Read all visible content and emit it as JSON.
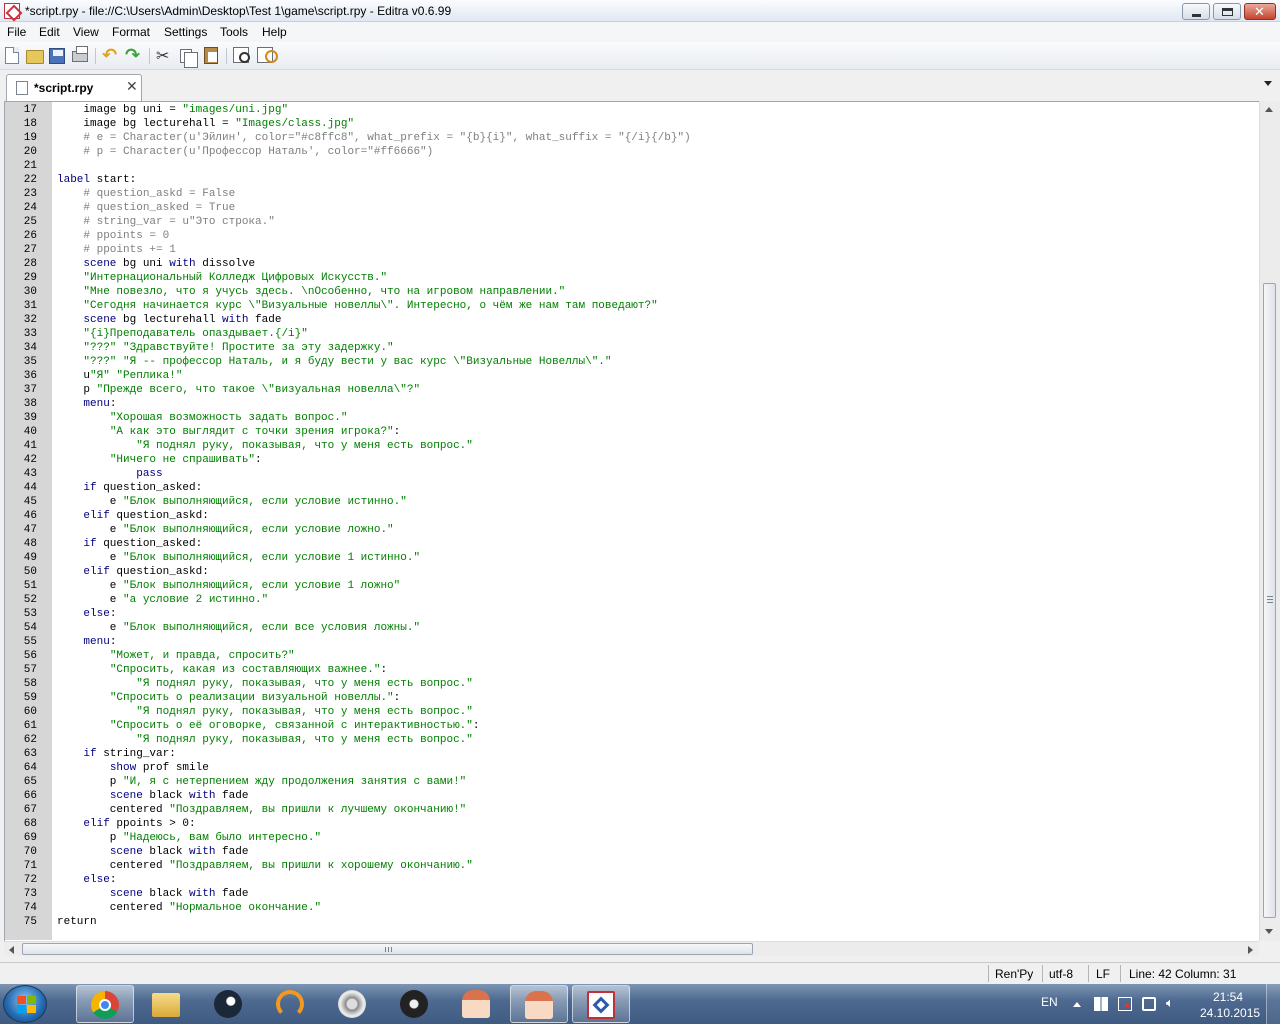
{
  "window": {
    "title": "*script.rpy - file://C:\\Users\\Admin\\Desktop\\Test 1\\game\\script.rpy - Editra v0.6.99",
    "close_glyph": "✕"
  },
  "menu": [
    "File",
    "Edit",
    "View",
    "Format",
    "Settings",
    "Tools",
    "Help"
  ],
  "toolbar_icons": [
    "new-file-icon",
    "open-folder-icon",
    "save-icon",
    "print-icon",
    "undo-icon",
    "redo-icon",
    "cut-icon",
    "copy-icon",
    "paste-icon",
    "find-icon",
    "find-replace-icon"
  ],
  "tab": {
    "label": "*script.rpy",
    "close_glyph": "✕"
  },
  "colors": {
    "keyword": "#00007f",
    "string": "#007f00",
    "comment": "#7f7f7f",
    "gutter": "#d6d6d6"
  },
  "editor": {
    "lines": [
      {
        "n": "17",
        "parts": [
          [
            "t",
            "    image bg uni = "
          ],
          [
            "s",
            "\"images/uni.jpg\""
          ]
        ]
      },
      {
        "n": "18",
        "parts": [
          [
            "t",
            "    image bg lecturehall = "
          ],
          [
            "s",
            "\"Images/class.jpg\""
          ]
        ]
      },
      {
        "n": "19",
        "parts": [
          [
            "c",
            "    # e = Character(u'Эйлин', color=\"#c8ffc8\", what_prefix = \"{b}{i}\", what_suffix = \"{/i}{/b}\")"
          ]
        ]
      },
      {
        "n": "20",
        "parts": [
          [
            "c",
            "    # p = Character(u'Профессор Наталь', color=\"#ff6666\")"
          ]
        ]
      },
      {
        "n": "21",
        "parts": []
      },
      {
        "n": "22",
        "parts": [
          [
            "k",
            "label"
          ],
          [
            "t",
            " start:"
          ]
        ]
      },
      {
        "n": "23",
        "parts": [
          [
            "c",
            "    # question_askd = False"
          ]
        ]
      },
      {
        "n": "24",
        "parts": [
          [
            "c",
            "    # question_asked = True"
          ]
        ]
      },
      {
        "n": "25",
        "parts": [
          [
            "c",
            "    # string_var = u\"Это строка.\""
          ]
        ]
      },
      {
        "n": "26",
        "parts": [
          [
            "c",
            "    # ppoints = 0"
          ]
        ]
      },
      {
        "n": "27",
        "parts": [
          [
            "c",
            "    # ppoints += 1"
          ]
        ]
      },
      {
        "n": "28",
        "parts": [
          [
            "t",
            "    "
          ],
          [
            "k",
            "scene"
          ],
          [
            "t",
            " bg uni "
          ],
          [
            "k",
            "with"
          ],
          [
            "t",
            " dissolve"
          ]
        ]
      },
      {
        "n": "29",
        "parts": [
          [
            "t",
            "    "
          ],
          [
            "s",
            "\"Интернациональный Колледж Цифровых Искусств.\""
          ]
        ]
      },
      {
        "n": "30",
        "parts": [
          [
            "t",
            "    "
          ],
          [
            "s",
            "\"Мне повезло, что я учусь здесь. \\nОсобенно, что на игровом направлении.\""
          ]
        ]
      },
      {
        "n": "31",
        "parts": [
          [
            "t",
            "    "
          ],
          [
            "s",
            "\"Сегодня начинается курс \\\"Визуальные новеллы\\\". Интересно, о чём же нам там поведают?\""
          ]
        ]
      },
      {
        "n": "32",
        "parts": [
          [
            "t",
            "    "
          ],
          [
            "k",
            "scene"
          ],
          [
            "t",
            " bg lecturehall "
          ],
          [
            "k",
            "with"
          ],
          [
            "t",
            " fade"
          ]
        ]
      },
      {
        "n": "33",
        "parts": [
          [
            "t",
            "    "
          ],
          [
            "s",
            "\"{i}Преподаватель опаздывает.{/i}\""
          ]
        ]
      },
      {
        "n": "34",
        "parts": [
          [
            "t",
            "    "
          ],
          [
            "s",
            "\"???\" \"Здравствуйте! Простите за эту задержку.\""
          ]
        ]
      },
      {
        "n": "35",
        "parts": [
          [
            "t",
            "    "
          ],
          [
            "s",
            "\"???\" \"Я -- профессор Наталь, и я буду вести у вас курс \\\"Визуальные Новеллы\\\".\""
          ]
        ]
      },
      {
        "n": "36",
        "parts": [
          [
            "t",
            "    u"
          ],
          [
            "s",
            "\"Я\" \"Реплика!\""
          ]
        ]
      },
      {
        "n": "37",
        "parts": [
          [
            "t",
            "    p "
          ],
          [
            "s",
            "\"Прежде всего, что такое \\\"визуальная новелла\\\"?\""
          ]
        ]
      },
      {
        "n": "38",
        "parts": [
          [
            "t",
            "    "
          ],
          [
            "k",
            "menu"
          ],
          [
            "t",
            ":"
          ]
        ]
      },
      {
        "n": "39",
        "parts": [
          [
            "t",
            "        "
          ],
          [
            "s",
            "\"Хорошая возможность задать вопрос.\""
          ]
        ]
      },
      {
        "n": "40",
        "parts": [
          [
            "t",
            "        "
          ],
          [
            "s",
            "\"А как это выглядит с точки зрения игрока?\""
          ],
          [
            "t",
            ":"
          ]
        ]
      },
      {
        "n": "41",
        "parts": [
          [
            "t",
            "            "
          ],
          [
            "s",
            "\"Я поднял руку, показывая, что у меня есть вопрос.\""
          ]
        ]
      },
      {
        "n": "42",
        "parts": [
          [
            "t",
            "        "
          ],
          [
            "s",
            "\"Ничего не спрашивать\""
          ],
          [
            "t",
            ":"
          ]
        ]
      },
      {
        "n": "43",
        "parts": [
          [
            "t",
            "            "
          ],
          [
            "k",
            "pass"
          ]
        ]
      },
      {
        "n": "44",
        "parts": [
          [
            "t",
            "    "
          ],
          [
            "k",
            "if"
          ],
          [
            "t",
            " question_asked:"
          ]
        ]
      },
      {
        "n": "45",
        "parts": [
          [
            "t",
            "        e "
          ],
          [
            "s",
            "\"Блок выполняющийся, если условие истинно.\""
          ]
        ]
      },
      {
        "n": "46",
        "parts": [
          [
            "t",
            "    "
          ],
          [
            "k",
            "elif"
          ],
          [
            "t",
            " question_askd:"
          ]
        ]
      },
      {
        "n": "47",
        "parts": [
          [
            "t",
            "        e "
          ],
          [
            "s",
            "\"Блок выполняющийся, если условие ложно.\""
          ]
        ]
      },
      {
        "n": "48",
        "parts": [
          [
            "t",
            "    "
          ],
          [
            "k",
            "if"
          ],
          [
            "t",
            " question_asked:"
          ]
        ]
      },
      {
        "n": "49",
        "parts": [
          [
            "t",
            "        e "
          ],
          [
            "s",
            "\"Блок выполняющийся, если условие 1 истинно.\""
          ]
        ]
      },
      {
        "n": "50",
        "parts": [
          [
            "t",
            "    "
          ],
          [
            "k",
            "elif"
          ],
          [
            "t",
            " question_askd:"
          ]
        ]
      },
      {
        "n": "51",
        "parts": [
          [
            "t",
            "        e "
          ],
          [
            "s",
            "\"Блок выполняющийся, если условие 1 ложно\""
          ]
        ]
      },
      {
        "n": "52",
        "parts": [
          [
            "t",
            "        e "
          ],
          [
            "s",
            "\"а условие 2 истинно.\""
          ]
        ]
      },
      {
        "n": "53",
        "parts": [
          [
            "t",
            "    "
          ],
          [
            "k",
            "else"
          ],
          [
            "t",
            ":"
          ]
        ]
      },
      {
        "n": "54",
        "parts": [
          [
            "t",
            "        e "
          ],
          [
            "s",
            "\"Блок выполняющийся, если все условия ложны.\""
          ]
        ]
      },
      {
        "n": "55",
        "parts": [
          [
            "t",
            "    "
          ],
          [
            "k",
            "menu"
          ],
          [
            "t",
            ":"
          ]
        ]
      },
      {
        "n": "56",
        "parts": [
          [
            "t",
            "        "
          ],
          [
            "s",
            "\"Может, и правда, спросить?\""
          ]
        ]
      },
      {
        "n": "57",
        "parts": [
          [
            "t",
            "        "
          ],
          [
            "s",
            "\"Спросить, какая из составляющих важнее.\""
          ],
          [
            "t",
            ":"
          ]
        ]
      },
      {
        "n": "58",
        "parts": [
          [
            "t",
            "            "
          ],
          [
            "s",
            "\"Я поднял руку, показывая, что у меня есть вопрос.\""
          ]
        ]
      },
      {
        "n": "59",
        "parts": [
          [
            "t",
            "        "
          ],
          [
            "s",
            "\"Спросить о реализации визуальной новеллы.\""
          ],
          [
            "t",
            ":"
          ]
        ]
      },
      {
        "n": "60",
        "parts": [
          [
            "t",
            "            "
          ],
          [
            "s",
            "\"Я поднял руку, показывая, что у меня есть вопрос.\""
          ]
        ]
      },
      {
        "n": "61",
        "parts": [
          [
            "t",
            "        "
          ],
          [
            "s",
            "\"Спросить о её оговорке, связанной с интерактивностью.\""
          ],
          [
            "t",
            ":"
          ]
        ]
      },
      {
        "n": "62",
        "parts": [
          [
            "t",
            "            "
          ],
          [
            "s",
            "\"Я поднял руку, показывая, что у меня есть вопрос.\""
          ]
        ]
      },
      {
        "n": "63",
        "parts": [
          [
            "t",
            "    "
          ],
          [
            "k",
            "if"
          ],
          [
            "t",
            " string_var:"
          ]
        ]
      },
      {
        "n": "64",
        "parts": [
          [
            "t",
            "        "
          ],
          [
            "k",
            "show"
          ],
          [
            "t",
            " prof smile"
          ]
        ]
      },
      {
        "n": "65",
        "parts": [
          [
            "t",
            "        p "
          ],
          [
            "s",
            "\"И, я с нетерпением жду продолжения занятия с вами!\""
          ]
        ]
      },
      {
        "n": "66",
        "parts": [
          [
            "t",
            "        "
          ],
          [
            "k",
            "scene"
          ],
          [
            "t",
            " black "
          ],
          [
            "k",
            "with"
          ],
          [
            "t",
            " fade"
          ]
        ]
      },
      {
        "n": "67",
        "parts": [
          [
            "t",
            "        centered "
          ],
          [
            "s",
            "\"Поздравляем, вы пришли к лучшему окончанию!\""
          ]
        ]
      },
      {
        "n": "68",
        "parts": [
          [
            "t",
            "    "
          ],
          [
            "k",
            "elif"
          ],
          [
            "t",
            " ppoints > 0:"
          ]
        ]
      },
      {
        "n": "69",
        "parts": [
          [
            "t",
            "        p "
          ],
          [
            "s",
            "\"Надеюсь, вам было интересно.\""
          ]
        ]
      },
      {
        "n": "70",
        "parts": [
          [
            "t",
            "        "
          ],
          [
            "k",
            "scene"
          ],
          [
            "t",
            " black "
          ],
          [
            "k",
            "with"
          ],
          [
            "t",
            " fade"
          ]
        ]
      },
      {
        "n": "71",
        "parts": [
          [
            "t",
            "        centered "
          ],
          [
            "s",
            "\"Поздравляем, вы пришли к хорошему окончанию.\""
          ]
        ]
      },
      {
        "n": "72",
        "parts": [
          [
            "t",
            "    "
          ],
          [
            "k",
            "else"
          ],
          [
            "t",
            ":"
          ]
        ]
      },
      {
        "n": "73",
        "parts": [
          [
            "t",
            "        "
          ],
          [
            "k",
            "scene"
          ],
          [
            "t",
            " black "
          ],
          [
            "k",
            "with"
          ],
          [
            "t",
            " fade"
          ]
        ]
      },
      {
        "n": "74",
        "parts": [
          [
            "t",
            "        centered "
          ],
          [
            "s",
            "\"Нормальное окончание.\""
          ]
        ]
      },
      {
        "n": "75",
        "parts": [
          [
            "t",
            "return"
          ]
        ]
      }
    ]
  },
  "status": {
    "lexer": "Ren'Py",
    "encoding": "utf-8",
    "eol": "LF",
    "position": "Line: 42  Column: 31"
  },
  "taskbar": {
    "apps": [
      "chrome-icon",
      "file-explorer-icon",
      "steam-icon",
      "headphones-icon",
      "xiii-disc-icon",
      "obs-icon",
      "anime-character-icon",
      "anime-character-icon",
      "editra-icon"
    ],
    "language": "EN",
    "time": "21:54",
    "date": "24.10.2015"
  }
}
